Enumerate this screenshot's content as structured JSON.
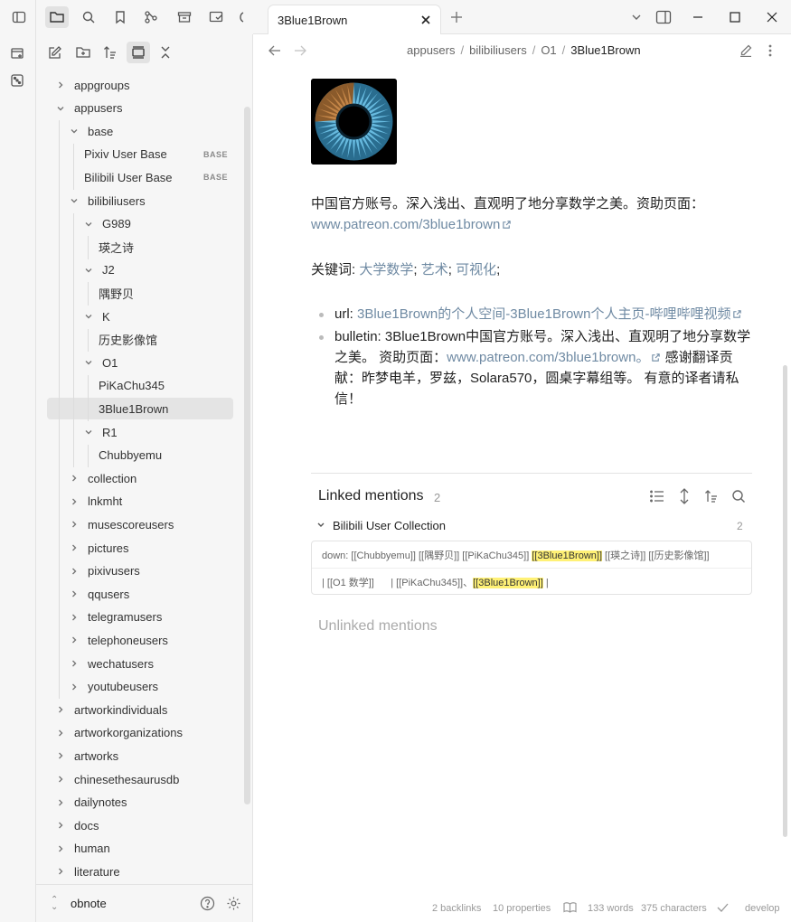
{
  "ribbon": {
    "items": [
      {
        "name": "new-canvas-icon"
      },
      {
        "name": "random-note-icon"
      }
    ]
  },
  "topbar": {
    "icons": [
      "sidebar-toggle-icon",
      "files-icon",
      "search-icon",
      "bookmark-icon",
      "graph-icon",
      "archive-icon",
      "outline-icon",
      "more-tabs-icon"
    ]
  },
  "sidebar": {
    "toolbar_icons": [
      "new-note-icon",
      "new-folder-icon",
      "sort-icon",
      "auto-reveal-icon",
      "collapse-all-icon"
    ],
    "tree": [
      {
        "label": "appgroups",
        "depth": 0,
        "expanded": false
      },
      {
        "label": "appusers",
        "depth": 0,
        "expanded": true
      },
      {
        "label": "base",
        "depth": 1,
        "expanded": true
      },
      {
        "label": "Pixiv User Base",
        "depth": 2,
        "file": true,
        "badge": "BASE"
      },
      {
        "label": "Bilibili User Base",
        "depth": 2,
        "file": true,
        "badge": "BASE"
      },
      {
        "label": "bilibiliusers",
        "depth": 1,
        "expanded": true
      },
      {
        "label": "G989",
        "depth": 2,
        "expanded": true
      },
      {
        "label": "瑛之诗",
        "depth": 3,
        "file": true
      },
      {
        "label": "J2",
        "depth": 2,
        "expanded": true
      },
      {
        "label": "隅野贝",
        "depth": 3,
        "file": true
      },
      {
        "label": "K",
        "depth": 2,
        "expanded": true
      },
      {
        "label": "历史影像馆",
        "depth": 3,
        "file": true
      },
      {
        "label": "O1",
        "depth": 2,
        "expanded": true
      },
      {
        "label": "PiKaChu345",
        "depth": 3,
        "file": true
      },
      {
        "label": "3Blue1Brown",
        "depth": 3,
        "file": true,
        "selected": true
      },
      {
        "label": "R1",
        "depth": 2,
        "expanded": true
      },
      {
        "label": "Chubbyemu",
        "depth": 3,
        "file": true
      },
      {
        "label": "collection",
        "depth": 1,
        "expanded": false
      },
      {
        "label": "lnkmht",
        "depth": 1,
        "expanded": false
      },
      {
        "label": "musescoreusers",
        "depth": 1,
        "expanded": false
      },
      {
        "label": "pictures",
        "depth": 1,
        "expanded": false
      },
      {
        "label": "pixivusers",
        "depth": 1,
        "expanded": false
      },
      {
        "label": "qqusers",
        "depth": 1,
        "expanded": false
      },
      {
        "label": "telegramusers",
        "depth": 1,
        "expanded": false
      },
      {
        "label": "telephoneusers",
        "depth": 1,
        "expanded": false
      },
      {
        "label": "wechatusers",
        "depth": 1,
        "expanded": false
      },
      {
        "label": "youtubeusers",
        "depth": 1,
        "expanded": false
      },
      {
        "label": "artworkindividuals",
        "depth": 0,
        "expanded": false
      },
      {
        "label": "artworkorganizations",
        "depth": 0,
        "expanded": false
      },
      {
        "label": "artworks",
        "depth": 0,
        "expanded": false
      },
      {
        "label": "chinesethesaurusdb",
        "depth": 0,
        "expanded": false
      },
      {
        "label": "dailynotes",
        "depth": 0,
        "expanded": false
      },
      {
        "label": "docs",
        "depth": 0,
        "expanded": false
      },
      {
        "label": "human",
        "depth": 0,
        "expanded": false
      },
      {
        "label": "literature",
        "depth": 0,
        "expanded": false
      }
    ],
    "vault_name": "obnote"
  },
  "tab": {
    "title": "3Blue1Brown"
  },
  "breadcrumb": {
    "parts": [
      "appusers",
      "bilibiliusers",
      "O1"
    ],
    "current": "3Blue1Brown",
    "separator": "/"
  },
  "note": {
    "intro_text": "中国官方账号。深入浅出、直观明了地分享数学之美。资助页面：",
    "intro_link": "www.patreon.com/3blue1brown",
    "keywords_label": "关键词: ",
    "keywords": [
      "大学数学",
      "艺术",
      "可视化"
    ],
    "keyword_sep": "; ",
    "keyword_end": ";",
    "url_label": "url: ",
    "url_link": "3Blue1Brown的个人空间-3Blue1Brown个人主页-哔哩哔哩视频",
    "bulletin_label": "bulletin: ",
    "bulletin_text_1": "3Blue1Brown中国官方账号。深入浅出、直观明了地分享数学之美。 资助页面：",
    "bulletin_link": "www.patreon.com/3blue1brown。",
    "bulletin_text_2": "感谢翻译贡献：昨梦电羊，罗兹，Solara570，圆桌字幕组等。 有意的译者请私信！"
  },
  "linked_mentions": {
    "title": "Linked mentions",
    "count": "2",
    "group_title": "Bilibili User Collection",
    "group_count": "2",
    "line1_pre": "down: [[Chubbyemu]] [[隅野贝]] [[PiKaChu345]] ",
    "line1_hl": "[[3Blue1Brown]]",
    "line1_post": " [[瑛之诗]] [[历史影像馆]]",
    "line2_pre": "| [[O1 数学]]      | [[PiKaChu345]]、",
    "line2_hl": "[[3Blue1Brown]]",
    "line2_post": " |"
  },
  "unlinked_mentions": {
    "title": "Unlinked mentions"
  },
  "status": {
    "backlinks": "2 backlinks",
    "properties": "10 properties",
    "words": "133 words",
    "characters": "375 characters",
    "branch": "develop"
  },
  "colors": {
    "accent_link": "#6f8aa3",
    "highlight": "#fff176",
    "sidebar_bg": "#f6f6f6"
  }
}
